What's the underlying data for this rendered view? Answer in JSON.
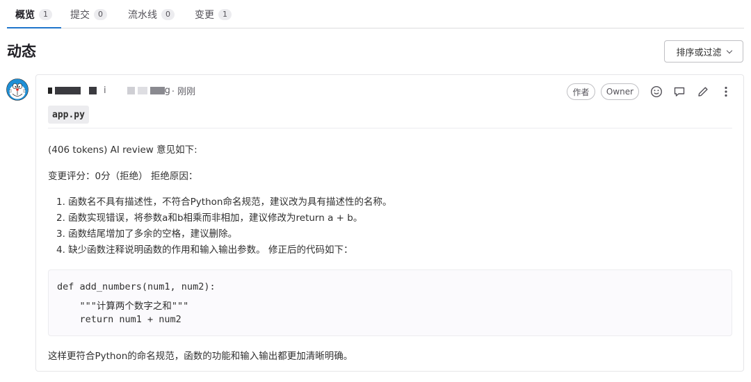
{
  "tabs": [
    {
      "label": "概览",
      "count": "1",
      "active": true
    },
    {
      "label": "提交",
      "count": "0",
      "active": false
    },
    {
      "label": "流水线",
      "count": "0",
      "active": false
    },
    {
      "label": "变更",
      "count": "1",
      "active": false
    }
  ],
  "page": {
    "title": "动态",
    "sort_button": "排序或过滤"
  },
  "note": {
    "author_fragment_1": "i",
    "author_fragment_2": "g",
    "time": "· 刚刚",
    "badge_author": "作者",
    "badge_owner": "Owner",
    "icons": [
      "smiley-icon",
      "comment-icon",
      "pencil-icon",
      "more-vertical-icon"
    ],
    "file_name": "app.py",
    "intro": "(406 tokens) AI review 意见如下:",
    "score_line": "变更评分：0分（拒绝） 拒绝原因：",
    "reasons": [
      "1. 函数名不具有描述性，不符合Python命名规范，建议改为具有描述性的名称。",
      "2. 函数实现错误，将参数a和b相乘而非相加，建议修改为return a + b。",
      "3. 函数结尾增加了多余的空格，建议删除。",
      "4. 缺少函数注释说明函数的作用和输入输出参数。 修正后的代码如下："
    ],
    "code_lines": [
      "def add_numbers(num1, num2):",
      "    \"\"\"计算两个数字之和\"\"\"",
      "    return num1 + num2"
    ],
    "conclusion": "这样更符合Python的命名规范，函数的功能和输入输出都更加清晰明确。"
  },
  "colors": {
    "accent": "#1f75cb",
    "text": "#303030",
    "muted": "#626168",
    "border": "#dcdcde"
  }
}
